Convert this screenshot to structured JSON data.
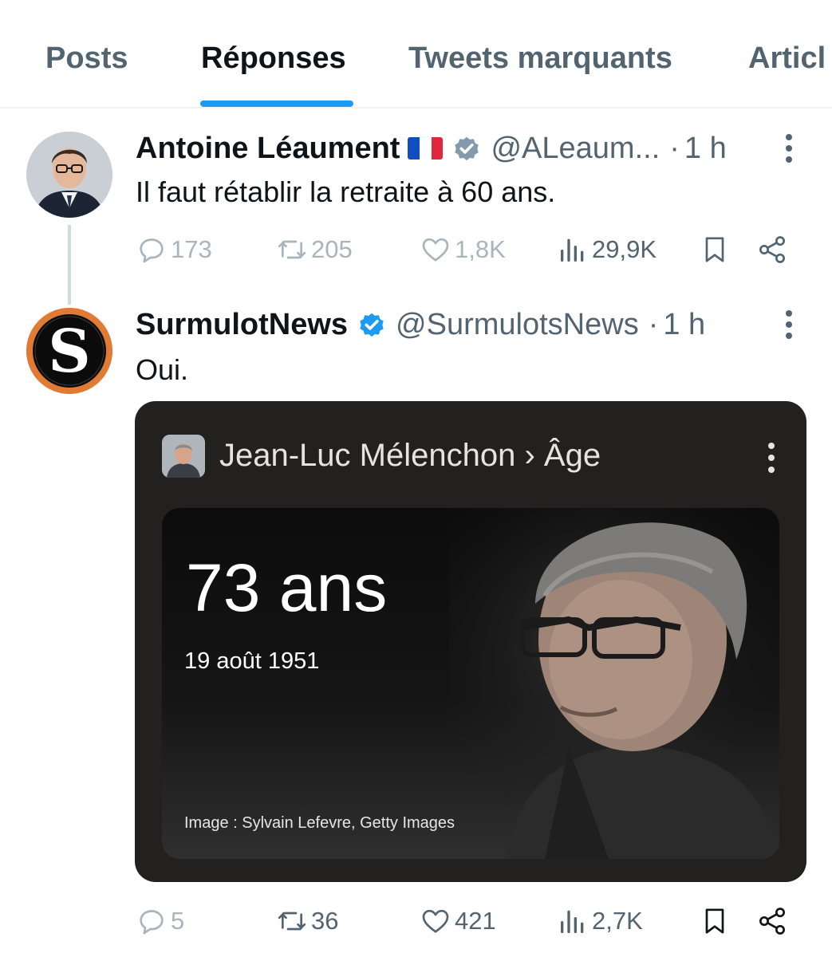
{
  "tabs": [
    {
      "label": "Posts",
      "active": false
    },
    {
      "label": "Réponses",
      "active": true
    },
    {
      "label": "Tweets marquants",
      "active": false
    },
    {
      "label": "Articl",
      "active": false
    }
  ],
  "tweets": [
    {
      "author": "Antoine Léaument",
      "flag": "French flag",
      "verified_badge": "gray-verified-badge",
      "handle": "@ALeaum...",
      "separator": "·",
      "time": "1 h",
      "text": "Il faut rétablir la retraite à 60 ans.",
      "stats": {
        "replies": "173",
        "retweets": "205",
        "likes": "1,8K",
        "views": "29,9K"
      }
    },
    {
      "author": "SurmulotNews",
      "verified_badge": "blue-verified-badge",
      "handle": "@SurmulotsNews",
      "separator": "·",
      "time": "1 h",
      "text": "Oui.",
      "stats": {
        "replies": "5",
        "retweets": "36",
        "likes": "421",
        "views": "2,7K"
      },
      "media": {
        "title": "Jean-Luc Mélenchon › Âge",
        "age": "73 ans",
        "birth_date": "19 août 1951",
        "credit": "Image : Sylvain Lefevre, Getty Images"
      }
    }
  ],
  "colors": {
    "accent": "#1d9bf0",
    "muted": "#536471",
    "faint": "#a9b5bd",
    "media_bg": "#222120"
  }
}
